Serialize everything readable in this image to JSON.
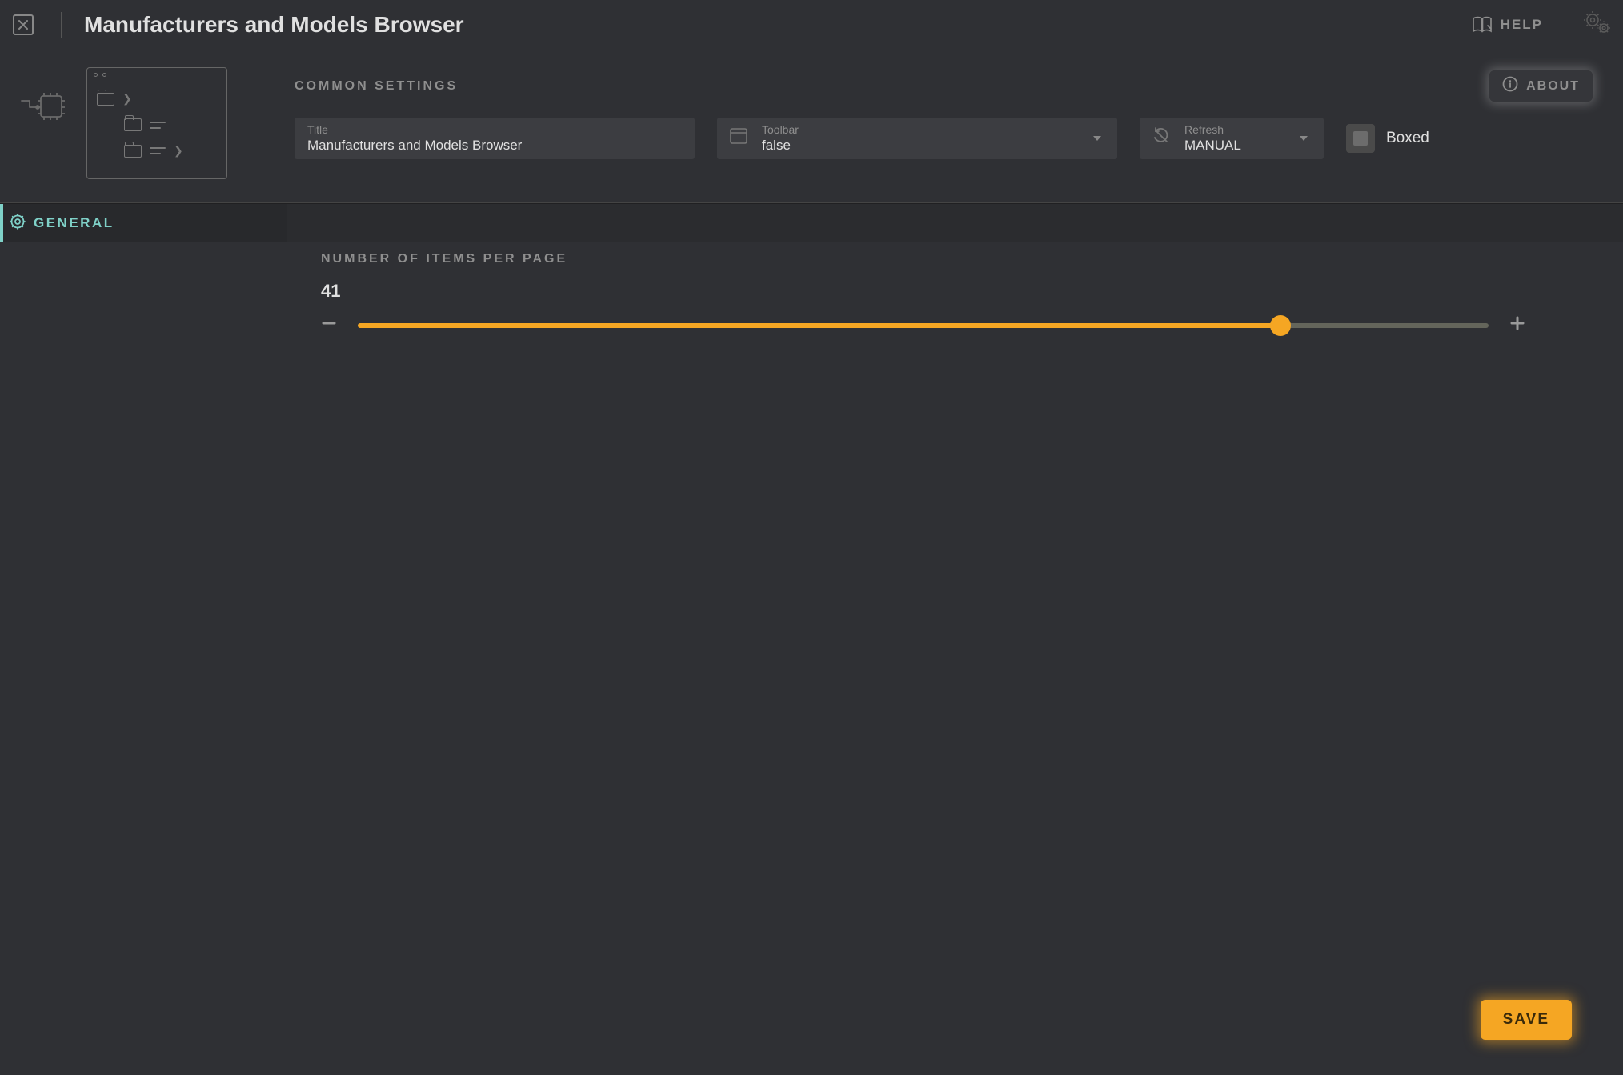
{
  "header": {
    "title": "Manufacturers and Models Browser",
    "help": "HELP"
  },
  "common": {
    "section": "COMMON SETTINGS",
    "about": "ABOUT",
    "title_field": {
      "label": "Title",
      "value": "Manufacturers and Models Browser"
    },
    "toolbar_field": {
      "label": "Toolbar",
      "value": "false"
    },
    "refresh_field": {
      "label": "Refresh",
      "value": "MANUAL"
    },
    "boxed": {
      "label": "Boxed",
      "checked": false
    }
  },
  "sidebar": {
    "tabs": [
      {
        "label": "GENERAL"
      }
    ]
  },
  "general": {
    "items_per_page": {
      "label": "NUMBER OF ITEMS PER PAGE",
      "value": "41",
      "min": 1,
      "max": 50
    }
  },
  "actions": {
    "save": "SAVE"
  }
}
